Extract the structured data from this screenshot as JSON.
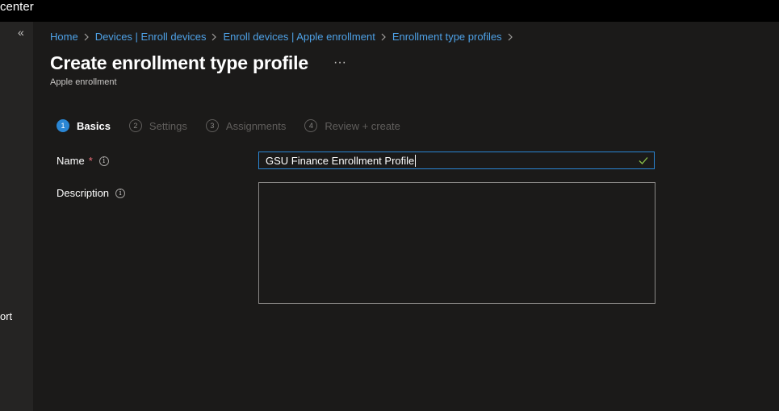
{
  "topbar": {
    "title_partial": "center"
  },
  "leftnav": {
    "collapse_glyph": "«",
    "partial_item": "ort"
  },
  "breadcrumb": [
    {
      "label": "Home"
    },
    {
      "label": "Devices | Enroll devices"
    },
    {
      "label": "Enroll devices | Apple enrollment"
    },
    {
      "label": "Enrollment type profiles"
    }
  ],
  "page": {
    "title": "Create enrollment type profile",
    "more_glyph": "···",
    "subtitle": "Apple enrollment"
  },
  "wizard": {
    "steps": [
      {
        "number": "1",
        "label": "Basics",
        "active": true
      },
      {
        "number": "2",
        "label": "Settings",
        "active": false
      },
      {
        "number": "3",
        "label": "Assignments",
        "active": false
      },
      {
        "number": "4",
        "label": "Review + create",
        "active": false
      }
    ]
  },
  "form": {
    "name_label": "Name",
    "required_marker": "*",
    "name_value": "GSU Finance Enrollment Profile",
    "description_label": "Description",
    "description_value": "",
    "info_glyph": "i"
  },
  "colors": {
    "accent": "#2a86d4",
    "link": "#4ea1e6",
    "background": "#1b1a19",
    "nav_background": "#252423",
    "valid_check": "#8bc34a"
  }
}
